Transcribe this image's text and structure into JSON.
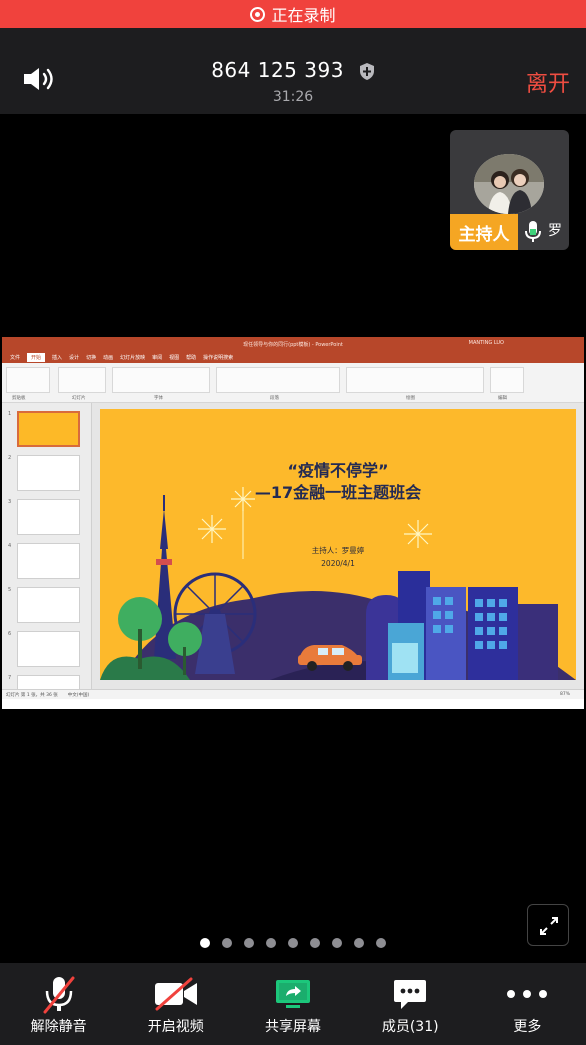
{
  "recording": {
    "label": "正在录制"
  },
  "header": {
    "meeting_id": "864 125 393",
    "elapsed": "31:26",
    "leave_label": "离开"
  },
  "host": {
    "tag": "主持人",
    "name": "罗"
  },
  "shared_screen": {
    "ppt": {
      "window_title": "现任领导与你的同行(ppt模板) - PowerPoint",
      "account": "MANTING LUO",
      "tabs": [
        "文件",
        "开始",
        "插入",
        "设计",
        "切换",
        "动画",
        "幻灯片放映",
        "审阅",
        "视图",
        "帮助",
        "操作说明搜索"
      ],
      "active_tab": "开始",
      "ribbon_groups": [
        "剪贴板",
        "幻灯片",
        "字体",
        "段落",
        "绘图",
        "编辑"
      ],
      "thumb_numbers": [
        "1",
        "2",
        "3",
        "4",
        "5",
        "6",
        "7"
      ],
      "status_left": "幻灯片 第 1 张，共 36 张",
      "status_lang": "中文(中国)",
      "zoom": "87%"
    },
    "slide": {
      "title_line1": "“疫情不停学”",
      "title_line2": "—17金融一班主题班会",
      "host_line": "主持人：罗曼婷",
      "date": "2020/4/1"
    }
  },
  "pager": {
    "count": 9,
    "active_index": 0
  },
  "toolbar": {
    "unmute": "解除静音",
    "video": "开启视频",
    "share": "共享屏幕",
    "members": "成员(31)",
    "more": "更多"
  },
  "colors": {
    "recording_red": "#f0423d",
    "leave_red": "#ef4d41",
    "host_tag": "#f5a623",
    "share_green": "#1cc77b",
    "slide_yellow": "#fdb92b"
  },
  "icons": [
    "speaker-icon",
    "shield-icon",
    "mic-icon",
    "mic-muted-icon",
    "video-off-icon",
    "share-screen-icon",
    "members-chat-icon",
    "more-dots-icon",
    "fullscreen-icon"
  ]
}
